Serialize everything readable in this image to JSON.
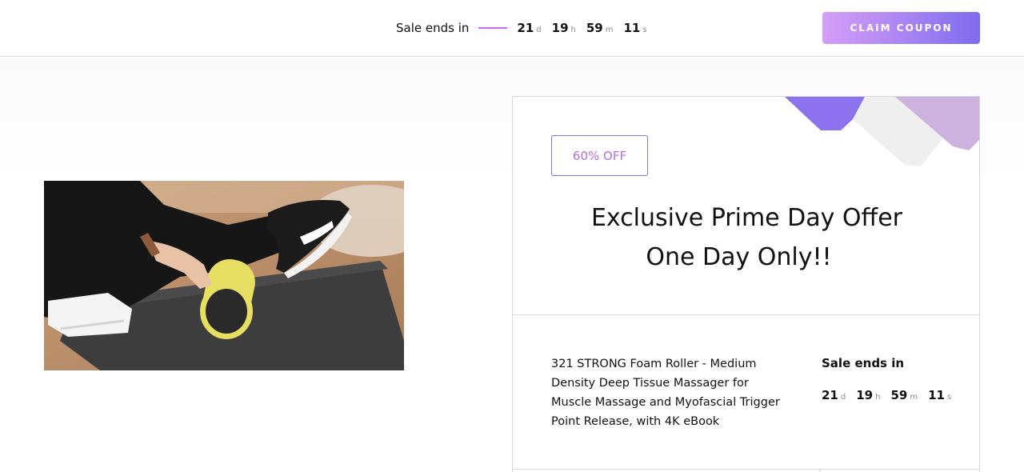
{
  "topbar": {
    "sale_label": "Sale ends in",
    "countdown": [
      {
        "value": "21",
        "unit": "d"
      },
      {
        "value": "19",
        "unit": "h"
      },
      {
        "value": "59",
        "unit": "m"
      },
      {
        "value": "11",
        "unit": "s"
      }
    ],
    "claim_label": "CLAIM COUPON"
  },
  "offer": {
    "badge": "60% OFF",
    "title_line1": "Exclusive Prime Day Offer",
    "title_line2": "One Day Only!!"
  },
  "product": {
    "name": "321 STRONG Foam Roller - Medium Density Deep Tissue Massager for Muscle Massage and Myofascial Trigger Point Release, with 4K eBook",
    "sale_label": "Sale ends in",
    "countdown": [
      {
        "value": "21",
        "unit": "d"
      },
      {
        "value": "19",
        "unit": "h"
      },
      {
        "value": "59",
        "unit": "m"
      },
      {
        "value": "11",
        "unit": "s"
      }
    ]
  },
  "colors": {
    "accent": "#b46ee0",
    "button_gradient_start": "#d49ef7",
    "button_gradient_end": "#7d6bee"
  }
}
